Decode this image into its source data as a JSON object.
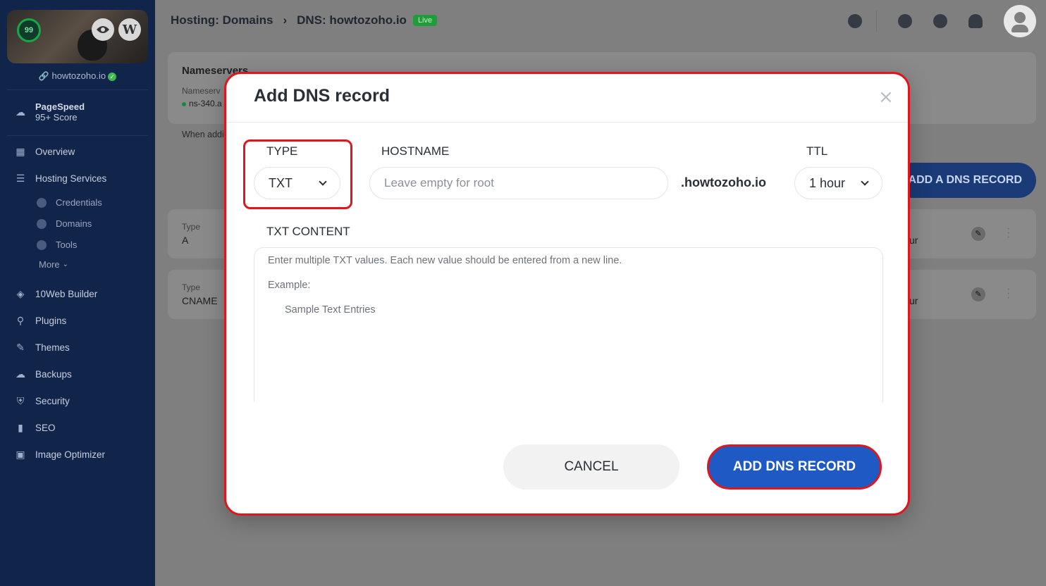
{
  "sidebar": {
    "score": "99",
    "wp_glyph": "W",
    "site_domain": "howtozoho.io",
    "pagespeed_title": "PageSpeed",
    "pagespeed_sub": "95+ Score",
    "items": [
      {
        "label": "Overview",
        "icon": "grid-icon"
      },
      {
        "label": "Hosting Services",
        "icon": "server-icon"
      }
    ],
    "sub_items": [
      {
        "label": "Credentials",
        "icon": "info-icon"
      },
      {
        "label": "Domains",
        "icon": "globe-icon"
      },
      {
        "label": "Tools",
        "icon": "tools-icon"
      }
    ],
    "more_label": "More",
    "items2": [
      {
        "label": "10Web Builder",
        "icon": "layers-icon"
      },
      {
        "label": "Plugins",
        "icon": "plug-icon"
      },
      {
        "label": "Themes",
        "icon": "brush-icon"
      },
      {
        "label": "Backups",
        "icon": "cloud-icon"
      },
      {
        "label": "Security",
        "icon": "shield-icon"
      },
      {
        "label": "SEO",
        "icon": "bar-chart-icon"
      },
      {
        "label": "Image Optimizer",
        "icon": "image-icon"
      }
    ]
  },
  "header": {
    "crumb1": "Hosting: Domains",
    "separator": "›",
    "crumb2": "DNS: howtozoho.io",
    "badge": "Live"
  },
  "background": {
    "nameservers_title": "Nameservers",
    "nameservers_label": "Nameserv",
    "ns_value": "ns-340.a",
    "when_text": "When addi",
    "add_record_button": "ADD A DNS RECORD",
    "rows": [
      {
        "type_label": "Type",
        "type_value": "A",
        "ttl_partial": "ur"
      },
      {
        "type_label": "Type",
        "type_value": "CNAME",
        "ttl_partial": "ur"
      }
    ]
  },
  "modal": {
    "title": "Add DNS record",
    "close_glyph": "×",
    "type_label": "TYPE",
    "type_value": "TXT",
    "hostname_label": "HOSTNAME",
    "hostname_placeholder": "Leave empty for root",
    "domain_suffix": ".howtozoho.io",
    "ttl_label": "TTL",
    "ttl_value": "1 hour",
    "content_label": "TXT CONTENT",
    "content_hint": "Enter multiple TXT values. Each new value should be entered from a new line.",
    "content_example_label": "Example:",
    "content_example_value": "Sample Text Entries",
    "cancel_label": "CANCEL",
    "submit_label": "ADD DNS RECORD"
  },
  "colors": {
    "sidebar_bg": "#11244a",
    "accent": "#1f59c4",
    "highlight": "#e0161e",
    "live_green": "#219c3a"
  }
}
